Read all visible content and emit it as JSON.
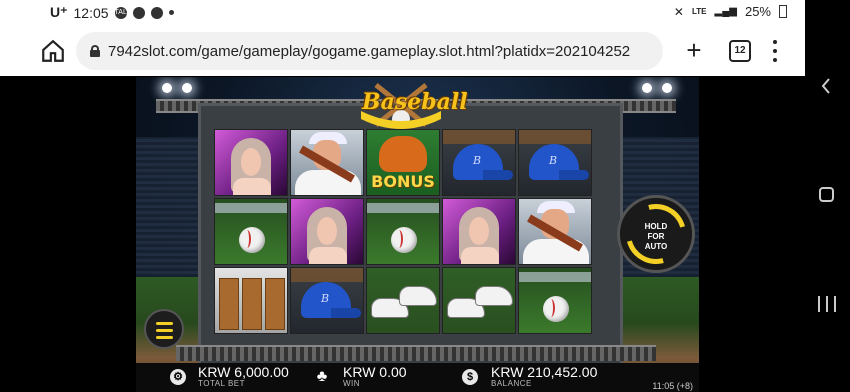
{
  "status": {
    "carrier": "U⁺",
    "time": "12:05",
    "notif_talk": "TALK",
    "signal": "LTE",
    "battery": "25%"
  },
  "browser": {
    "url": "7942slot.com/game/gameplay/gogame.gameplay.slot.html?platidx=202104252",
    "tabs_count": "12"
  },
  "game": {
    "logo": "Baseball",
    "bonus_label": "BONUS",
    "hold_label": "HOLD\nFOR\nAUTO",
    "reels": [
      [
        "girl",
        "player",
        "bonus",
        "cap",
        "cap"
      ],
      [
        "ball",
        "girl",
        "ball",
        "girl",
        "player"
      ],
      [
        "locker",
        "cap",
        "shoes",
        "shoes",
        "ball"
      ]
    ],
    "total_bet": {
      "amount": "KRW 6,000.00",
      "label": "TOTAL BET"
    },
    "win": {
      "amount": "KRW 0.00",
      "label": "WIN"
    },
    "balance": {
      "amount": "KRW 210,452.00",
      "label": "BALANCE"
    },
    "clock": "11:05 (+8)"
  },
  "icons": {
    "home": "home-icon",
    "lock": "lock-icon",
    "add": "plus-icon",
    "tabs": "tabs-icon",
    "menu": "more-vert-icon",
    "bet": "chip-icon",
    "win": "clover-icon",
    "balance": "dollar-icon"
  },
  "colors": {
    "accent": "#f4cf25",
    "girl_bg": "#d25bd8",
    "cap": "#2155c9"
  }
}
